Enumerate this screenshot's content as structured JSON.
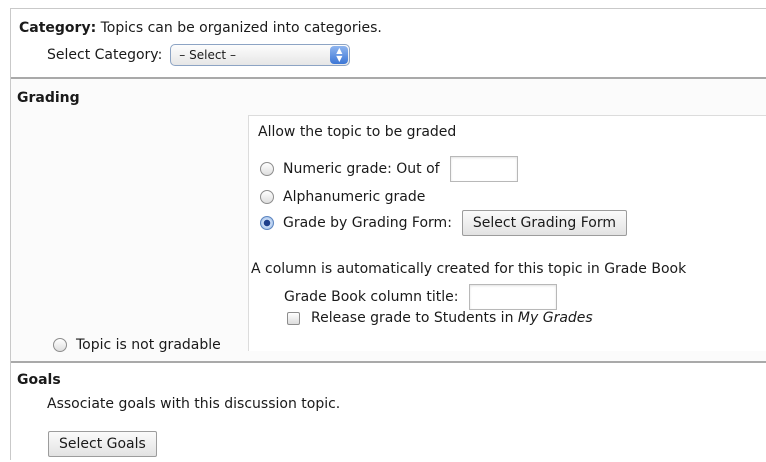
{
  "category": {
    "heading": "Category:",
    "description": " Topics can be organized into categories.",
    "select_label": "Select Category:",
    "select_value": "– Select –"
  },
  "grading": {
    "heading": "Grading",
    "allow_label": "Allow the topic to be graded",
    "numeric_label": "Numeric grade: Out of",
    "numeric_value": "",
    "alphanumeric_label": "Alphanumeric grade",
    "form_label": "Grade by Grading Form:",
    "select_form_button": "Select Grading Form",
    "selected_option": "grade-by-grading-form",
    "column_note": "A column is automatically created for this topic in Grade Book",
    "column_title_label": "Grade Book column title:",
    "column_title_value": "",
    "release_label_prefix": "Release grade to Students in ",
    "release_label_emph": "My Grades",
    "not_gradable_label": "Topic is not gradable"
  },
  "goals": {
    "heading": "Goals",
    "description": "Associate goals with this discussion topic.",
    "select_button": "Select Goals"
  }
}
